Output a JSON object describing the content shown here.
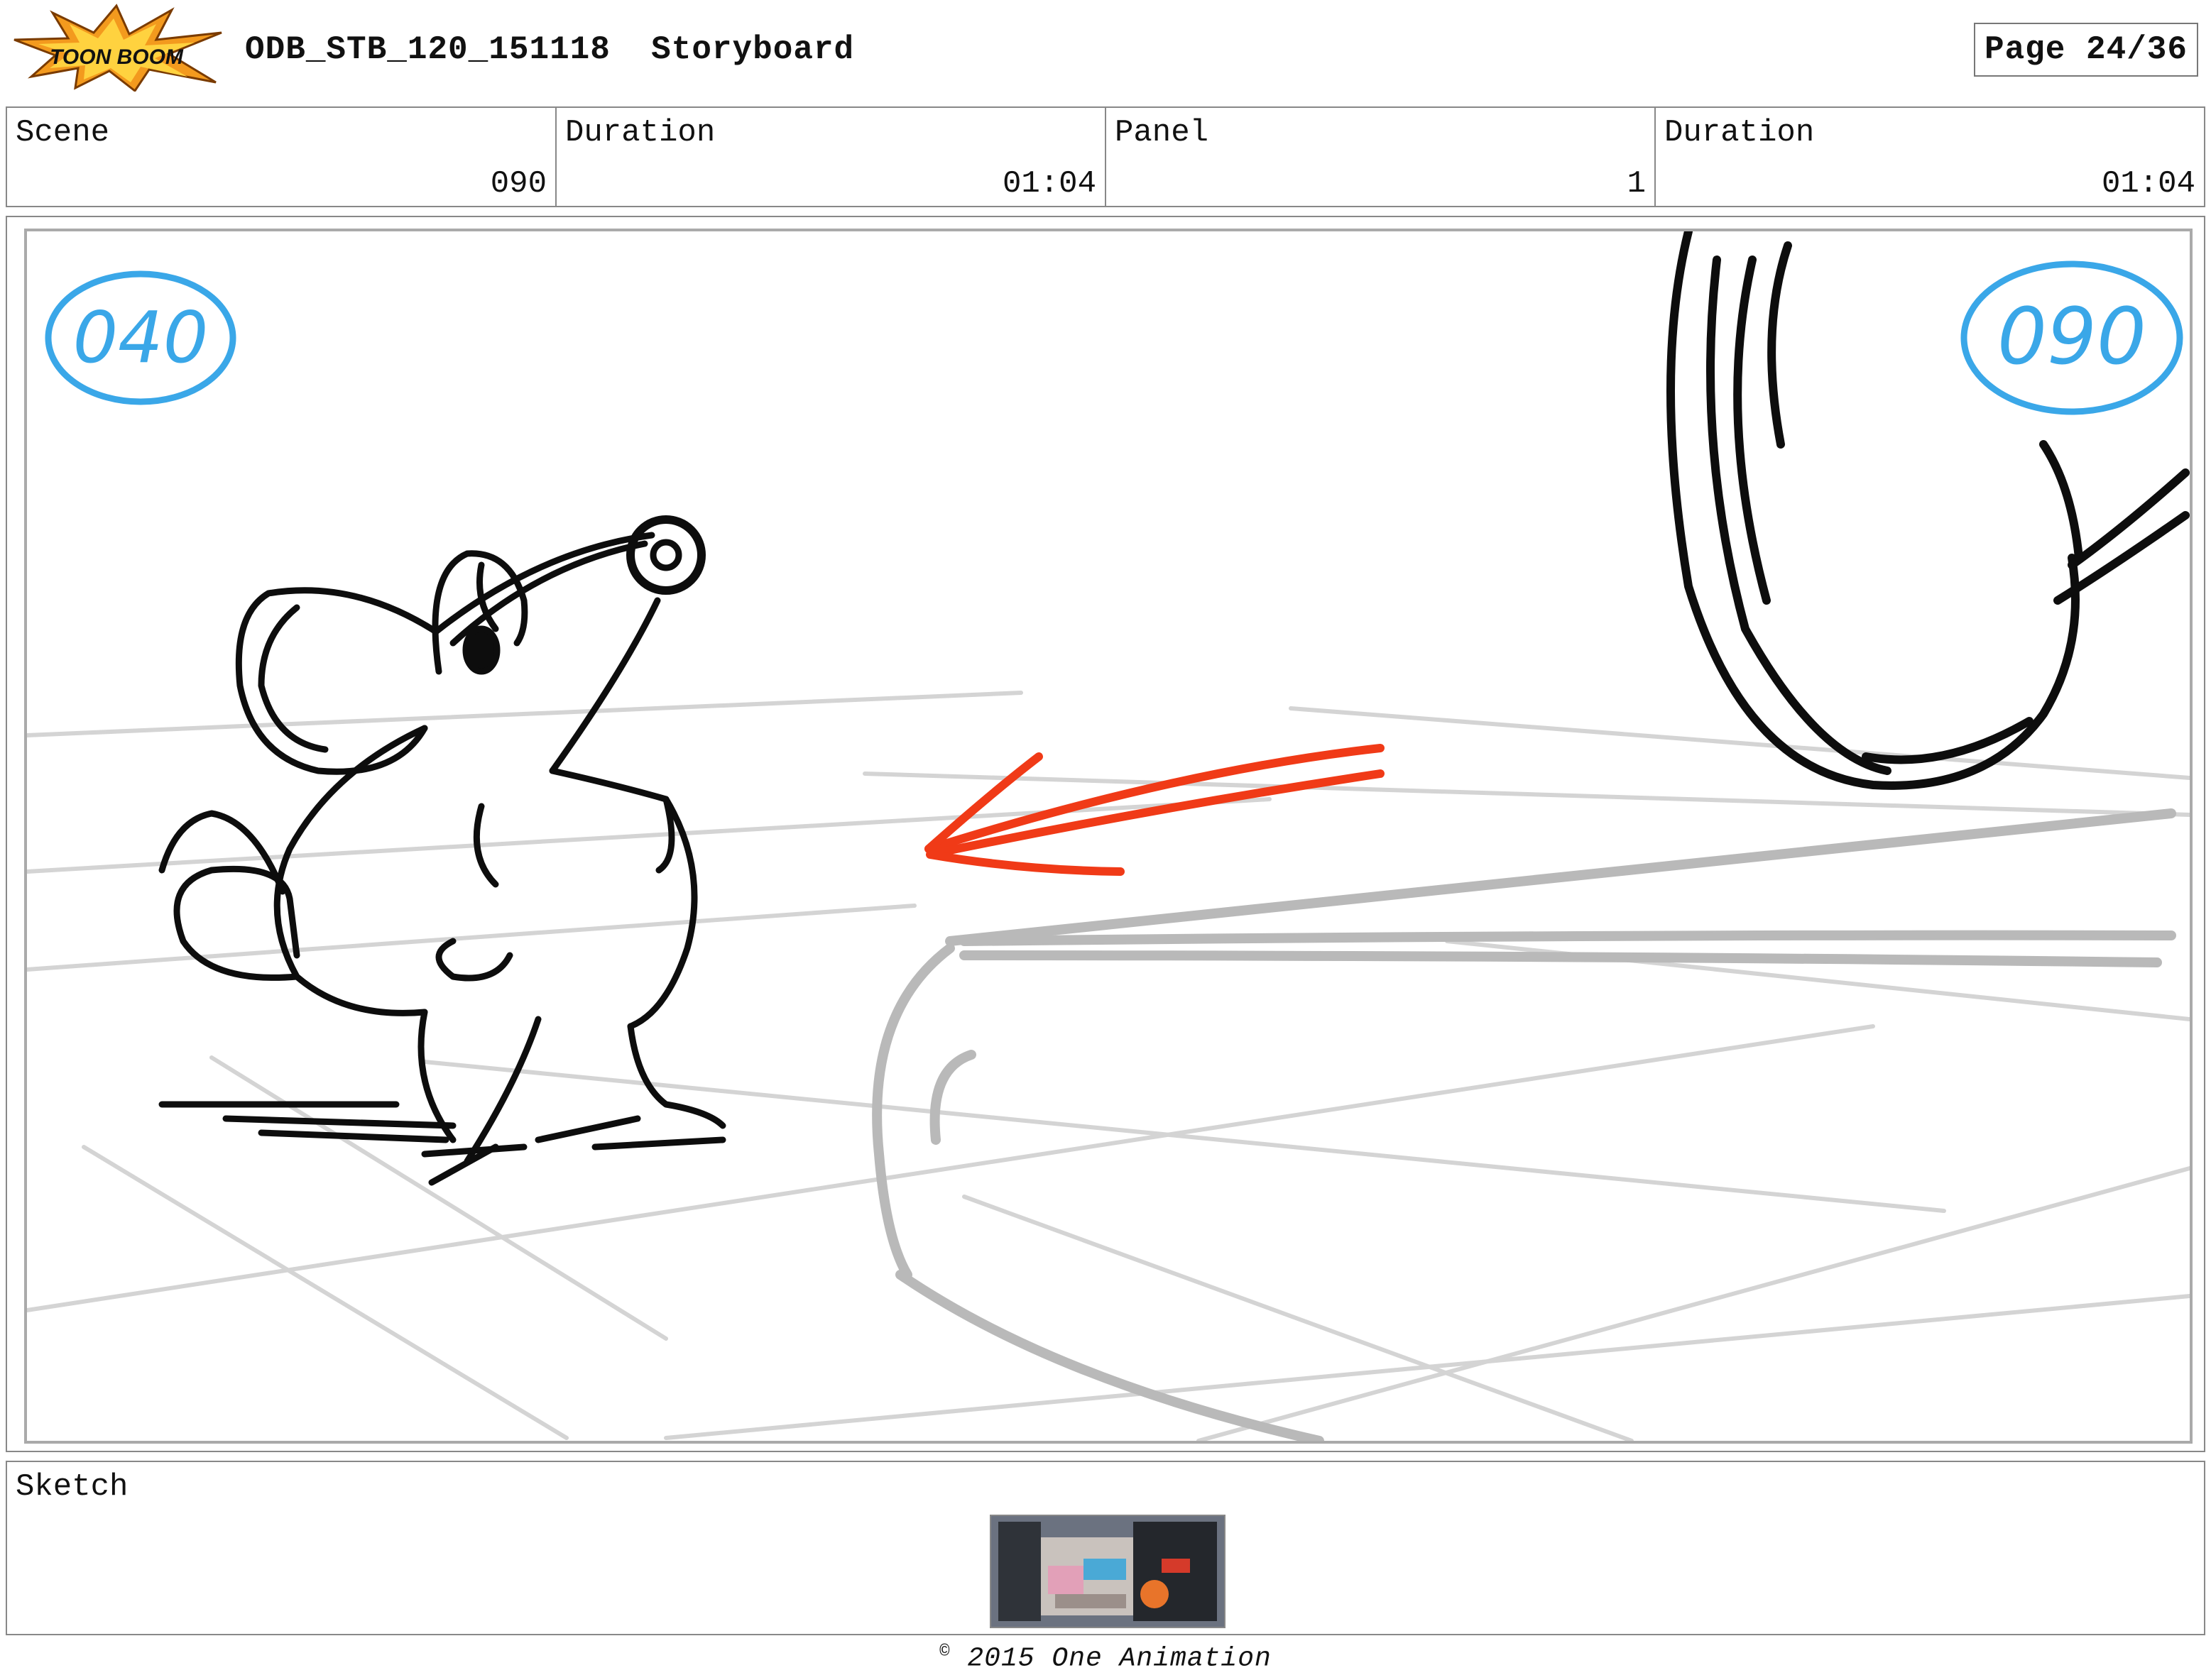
{
  "header": {
    "logo_text": "TOON BOOM",
    "project": "ODB_STB_120_151118",
    "doc_type": "Storyboard",
    "page_label": "Page 24/36"
  },
  "info": {
    "scene_label": "Scene",
    "scene_value": "090",
    "scene_duration_label": "Duration",
    "scene_duration_value": "01:04",
    "panel_label": "Panel",
    "panel_value": "1",
    "panel_duration_label": "Duration",
    "panel_duration_value": "01:04"
  },
  "panel": {
    "marker_left": "040",
    "marker_right": "090",
    "marker_color": "#3aa7e8",
    "arrow_color": "#f03a17"
  },
  "sketch": {
    "label": "Sketch"
  },
  "footer": {
    "copyright_symbol": "©",
    "copyright_text": "2015 One Animation"
  }
}
